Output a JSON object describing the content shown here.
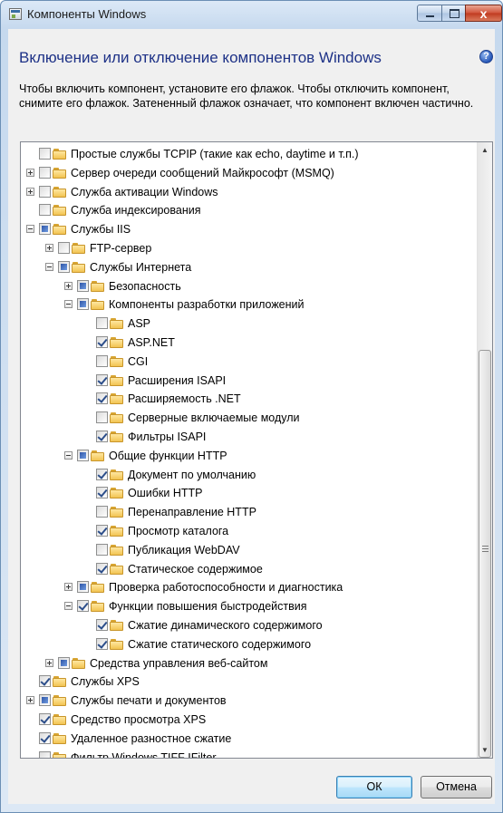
{
  "window": {
    "title": "Компоненты Windows",
    "close_glyph": "x"
  },
  "header": {
    "heading": "Включение или отключение компонентов Windows",
    "help_glyph": "?",
    "description": "Чтобы включить компонент, установите его флажок. Чтобы отключить компонент, снимите его флажок. Затененный флажок означает, что компонент включен частично."
  },
  "tree": {
    "items": [
      {
        "label": "Простые службы TCPIP (такие как echo, daytime и т.п.)",
        "level": 0,
        "state": "unchecked",
        "expander": "none"
      },
      {
        "label": "Сервер очереди сообщений Майкрософт (MSMQ)",
        "level": 0,
        "state": "unchecked",
        "expander": "collapsed"
      },
      {
        "label": "Служба активации Windows",
        "level": 0,
        "state": "unchecked",
        "expander": "collapsed"
      },
      {
        "label": "Служба индексирования",
        "level": 0,
        "state": "unchecked",
        "expander": "none"
      },
      {
        "label": "Службы IIS",
        "level": 0,
        "state": "partial",
        "expander": "expanded"
      },
      {
        "label": "FTP-сервер",
        "level": 1,
        "state": "unchecked",
        "expander": "collapsed"
      },
      {
        "label": "Службы Интернета",
        "level": 1,
        "state": "partial",
        "expander": "expanded"
      },
      {
        "label": "Безопасность",
        "level": 2,
        "state": "partial",
        "expander": "collapsed"
      },
      {
        "label": "Компоненты разработки приложений",
        "level": 2,
        "state": "partial",
        "expander": "expanded"
      },
      {
        "label": "ASP",
        "level": 3,
        "state": "unchecked",
        "expander": "none"
      },
      {
        "label": "ASP.NET",
        "level": 3,
        "state": "checked",
        "expander": "none"
      },
      {
        "label": "CGI",
        "level": 3,
        "state": "unchecked",
        "expander": "none"
      },
      {
        "label": "Расширения ISAPI",
        "level": 3,
        "state": "checked",
        "expander": "none"
      },
      {
        "label": "Расширяемость .NET",
        "level": 3,
        "state": "checked",
        "expander": "none"
      },
      {
        "label": "Серверные включаемые модули",
        "level": 3,
        "state": "unchecked",
        "expander": "none"
      },
      {
        "label": "Фильтры ISAPI",
        "level": 3,
        "state": "checked",
        "expander": "none"
      },
      {
        "label": "Общие функции HTTP",
        "level": 2,
        "state": "partial",
        "expander": "expanded"
      },
      {
        "label": "Документ по умолчанию",
        "level": 3,
        "state": "checked",
        "expander": "none"
      },
      {
        "label": "Ошибки HTTP",
        "level": 3,
        "state": "checked",
        "expander": "none"
      },
      {
        "label": "Перенаправление HTTP",
        "level": 3,
        "state": "unchecked",
        "expander": "none"
      },
      {
        "label": "Просмотр каталога",
        "level": 3,
        "state": "checked",
        "expander": "none"
      },
      {
        "label": "Публикация WebDAV",
        "level": 3,
        "state": "unchecked",
        "expander": "none"
      },
      {
        "label": "Статическое содержимое",
        "level": 3,
        "state": "checked",
        "expander": "none"
      },
      {
        "label": "Проверка работоспособности и диагностика",
        "level": 2,
        "state": "partial",
        "expander": "collapsed"
      },
      {
        "label": "Функции повышения быстродействия",
        "level": 2,
        "state": "checked",
        "expander": "expanded"
      },
      {
        "label": "Сжатие динамического содержимого",
        "level": 3,
        "state": "checked",
        "expander": "none"
      },
      {
        "label": "Сжатие статического содержимого",
        "level": 3,
        "state": "checked",
        "expander": "none"
      },
      {
        "label": "Средства управления веб-сайтом",
        "level": 1,
        "state": "partial",
        "expander": "collapsed"
      },
      {
        "label": "Службы XPS",
        "level": 0,
        "state": "checked",
        "expander": "none"
      },
      {
        "label": "Службы печати и документов",
        "level": 0,
        "state": "partial",
        "expander": "collapsed"
      },
      {
        "label": "Средство просмотра XPS",
        "level": 0,
        "state": "checked",
        "expander": "none"
      },
      {
        "label": "Удаленное разностное сжатие",
        "level": 0,
        "state": "checked",
        "expander": "none"
      },
      {
        "label": "Фильтр Windows TIFF IFilter",
        "level": 0,
        "state": "unchecked",
        "expander": "none"
      }
    ]
  },
  "scrollbar": {
    "up_glyph": "▲",
    "down_glyph": "▼"
  },
  "footer": {
    "ok_label": "ОК",
    "cancel_label": "Отмена"
  }
}
